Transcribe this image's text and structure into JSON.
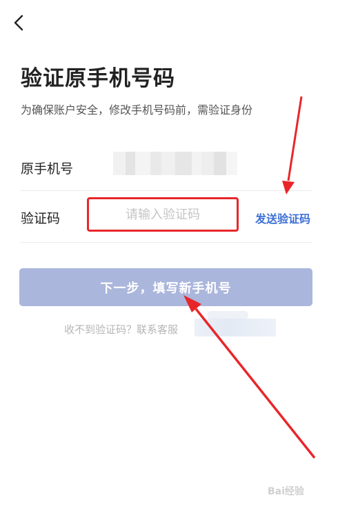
{
  "header": {
    "title": "验证原手机号码",
    "subtitle": "为确保账户安全，修改手机号码前，需验证身份"
  },
  "phone_row": {
    "label": "原手机号"
  },
  "code_row": {
    "label": "验证码",
    "input_value": "",
    "input_placeholder": "请输入验证码",
    "send_label": "发送验证码"
  },
  "next_button": {
    "label": "下一步，填写新手机号"
  },
  "help": {
    "text": "收不到验证码？联系客服"
  },
  "watermark": {
    "text": "Bai经验"
  },
  "colors": {
    "accent_blue": "#3c6fd6",
    "button_disabled": "#abb6dc",
    "annotation_red": "#e8262a"
  }
}
